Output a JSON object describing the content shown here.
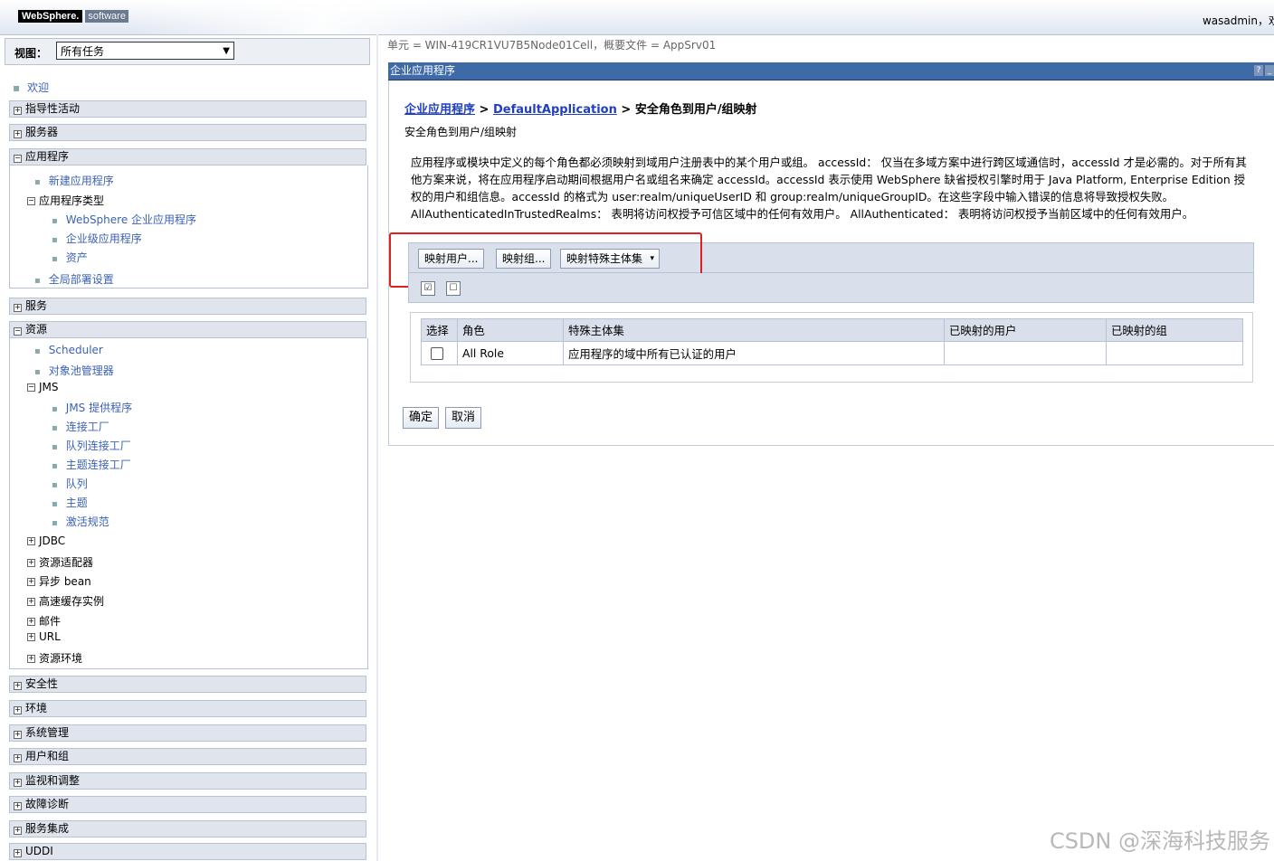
{
  "header": {
    "logo_brand": "WebSphere.",
    "logo_suffix": "software",
    "user": "wasadmin，欢"
  },
  "nav": {
    "view_label": "视图：",
    "view_value": "所有任务",
    "welcome": "欢迎",
    "sections": {
      "guided": "指导性活动",
      "servers": "服务器",
      "applications": "应用程序",
      "services": "服务",
      "resources": "资源",
      "security": "安全性",
      "environment": "环境",
      "sysadmin": "系统管理",
      "users_groups": "用户和组",
      "monitoring": "监视和调整",
      "troubleshooting": "故障诊断",
      "service_integration": "服务集成",
      "uddi": "UDDI"
    },
    "app_items": {
      "new_app": "新建应用程序",
      "app_types": "应用程序类型",
      "websphere_apps": "WebSphere 企业应用程序",
      "enterprise_apps": "企业级应用程序",
      "assets": "资产",
      "global_deploy": "全局部署设置"
    },
    "res_items": {
      "scheduler": "Scheduler",
      "object_pool": "对象池管理器",
      "jms": "JMS",
      "jms_providers": "JMS 提供程序",
      "conn_factories": "连接工厂",
      "queue_conn_factories": "队列连接工厂",
      "topic_conn_factories": "主题连接工厂",
      "queues": "队列",
      "topics": "主题",
      "activation_specs": "激活规范",
      "jdbc": "JDBC",
      "resource_adapters": "资源适配器",
      "async_beans": "异步 bean",
      "cache_instances": "高速缓存实例",
      "mail": "邮件",
      "url": "URL",
      "res_env": "资源环境"
    }
  },
  "main": {
    "scope": "单元 = WIN-419CR1VU7B5Node01Cell，概要文件 = AppSrv01",
    "panel_title": "企业应用程序",
    "help": "?",
    "minimize": "_",
    "breadcrumb": {
      "link1": "企业应用程序",
      "sep1": " > ",
      "link2": "DefaultApplication",
      "sep2": " > ",
      "current": "安全角色到用户/组映射"
    },
    "subtitle": "安全角色到用户/组映射",
    "description": "应用程序或模块中定义的每个角色都必须映射到域用户注册表中的某个用户或组。 accessId： 仅当在多域方案中进行跨区域通信时，accessId 才是必需的。对于所有其他方案来说，将在应用程序启动期间根据用户名或组名来确定 accessId。accessId 表示使用 WebSphere 缺省授权引擎时用于 Java Platform, Enterprise Edition 授权的用户和组信息。accessId 的格式为 user:realm/uniqueUserID 和 group:realm/uniqueGroupID。在这些字段中输入错误的信息将导致授权失败。 AllAuthenticatedInTrustedRealms： 表明将访问权授予可信区域中的任何有效用户。 AllAuthenticated： 表明将访问权授予当前区域中的任何有效用户。",
    "toolbar": {
      "map_users": "映射用户...",
      "map_groups": "映射组...",
      "map_special": "映射特殊主体集",
      "dropdown_arrow": "▾"
    },
    "table": {
      "headers": [
        "选择",
        "角色",
        "特殊主体集",
        "已映射的用户",
        "已映射的组"
      ],
      "rows": [
        {
          "role": "All Role",
          "special": "应用程序的域中所有已认证的用户",
          "users": "",
          "groups": ""
        }
      ]
    },
    "ok": "确定",
    "cancel": "取消"
  },
  "watermark": "CSDN @深海科技服务"
}
